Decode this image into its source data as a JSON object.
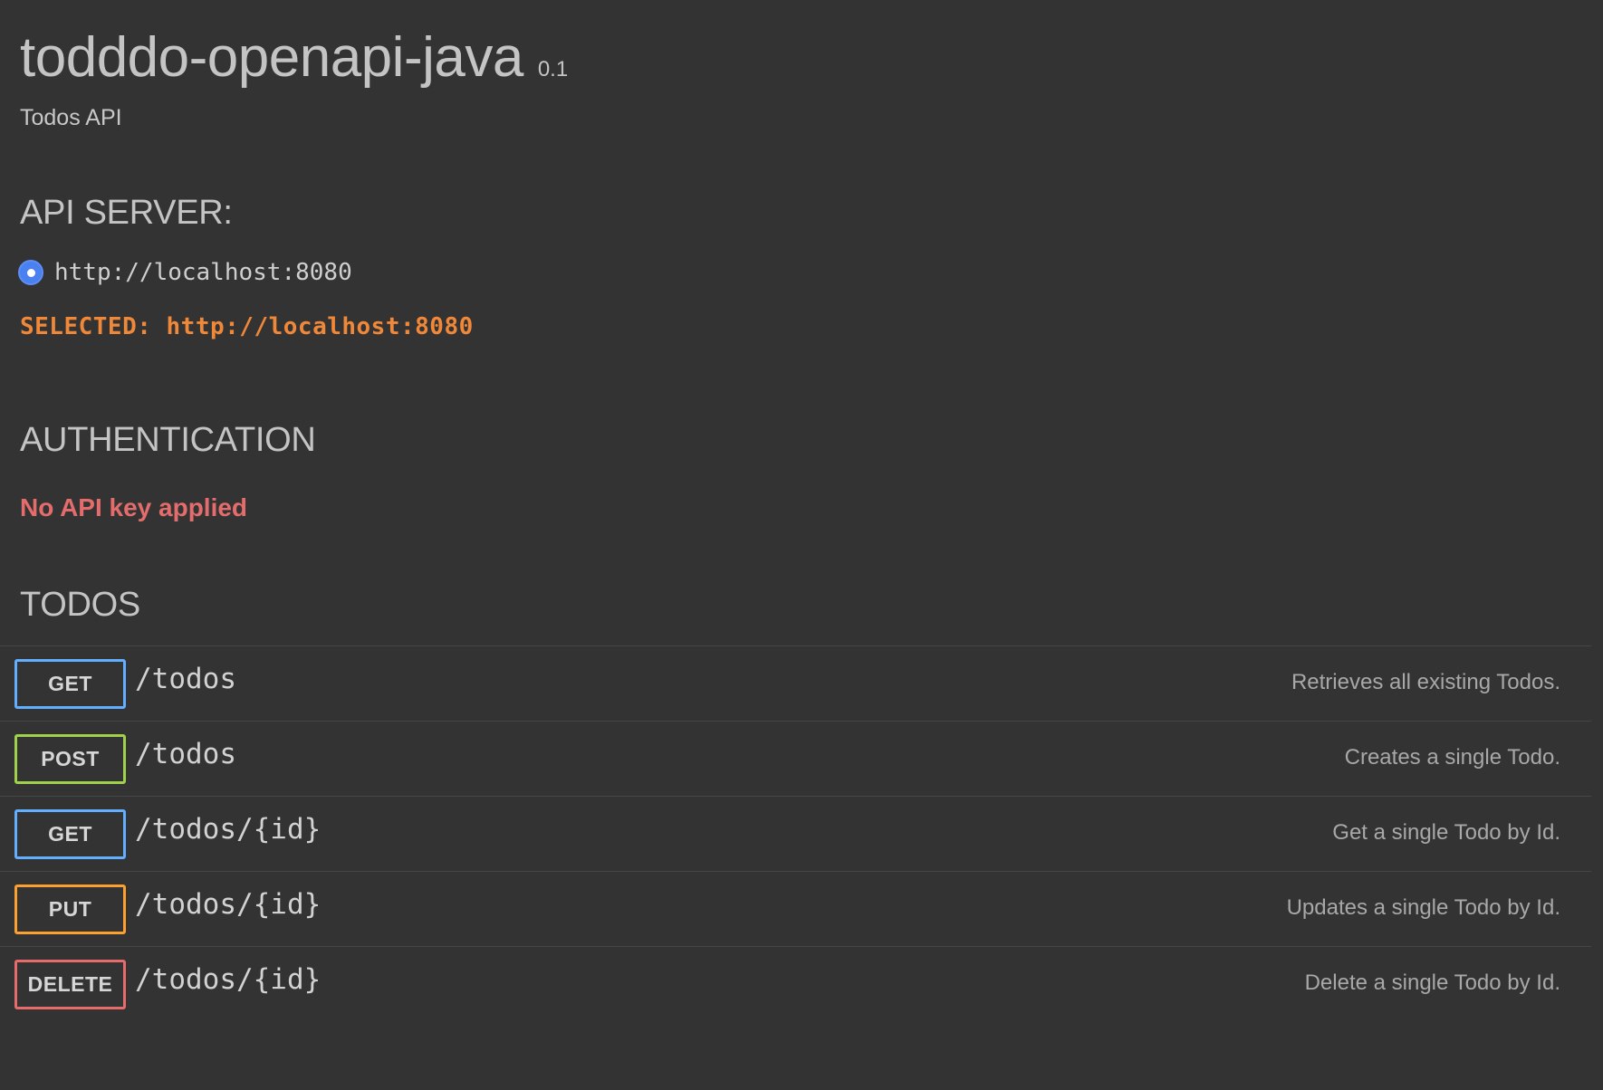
{
  "header": {
    "title": "todddo-openapi-java",
    "version": "0.1",
    "subtitle": "Todos API"
  },
  "api_server": {
    "heading": "API SERVER:",
    "options": [
      "http://localhost:8080"
    ],
    "selected_text": "SELECTED: http://localhost:8080"
  },
  "authentication": {
    "heading": "AUTHENTICATION",
    "status": "No API key applied"
  },
  "todos": {
    "heading": "TODOS",
    "endpoints": [
      {
        "method": "GET",
        "path": "/todos",
        "description": "Retrieves all existing Todos."
      },
      {
        "method": "POST",
        "path": "/todos",
        "description": "Creates a single Todo."
      },
      {
        "method": "GET",
        "path": "/todos/{id}",
        "description": "Get a single Todo by Id."
      },
      {
        "method": "PUT",
        "path": "/todos/{id}",
        "description": "Updates a single Todo by Id."
      },
      {
        "method": "DELETE",
        "path": "/todos/{id}",
        "description": "Delete a single Todo by Id."
      }
    ]
  },
  "colors": {
    "background": "#333333",
    "get": "#61affe",
    "post": "#9fd14a",
    "put": "#fca130",
    "delete": "#e66b6b",
    "selected_server": "#f0883a",
    "auth_warning": "#e36d6d",
    "radio": "#4a80f0"
  }
}
